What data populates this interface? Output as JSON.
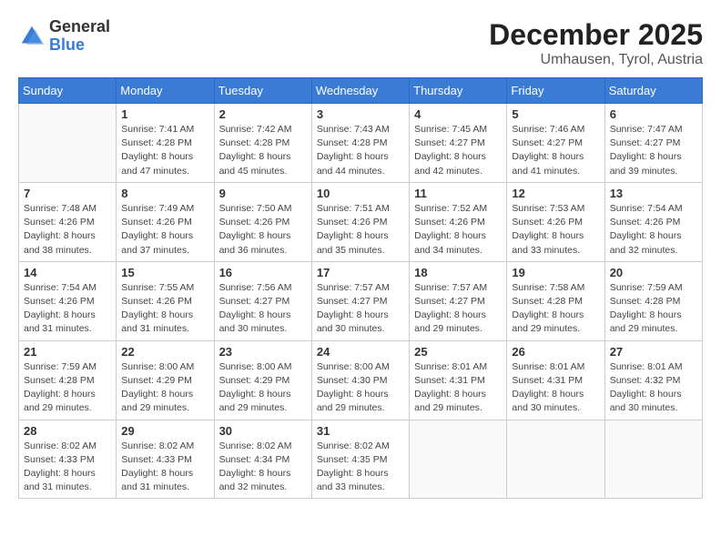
{
  "header": {
    "logo_general": "General",
    "logo_blue": "Blue",
    "month_year": "December 2025",
    "location": "Umhausen, Tyrol, Austria"
  },
  "weekdays": [
    "Sunday",
    "Monday",
    "Tuesday",
    "Wednesday",
    "Thursday",
    "Friday",
    "Saturday"
  ],
  "weeks": [
    [
      {
        "day": "",
        "info": ""
      },
      {
        "day": "1",
        "info": "Sunrise: 7:41 AM\nSunset: 4:28 PM\nDaylight: 8 hours\nand 47 minutes."
      },
      {
        "day": "2",
        "info": "Sunrise: 7:42 AM\nSunset: 4:28 PM\nDaylight: 8 hours\nand 45 minutes."
      },
      {
        "day": "3",
        "info": "Sunrise: 7:43 AM\nSunset: 4:28 PM\nDaylight: 8 hours\nand 44 minutes."
      },
      {
        "day": "4",
        "info": "Sunrise: 7:45 AM\nSunset: 4:27 PM\nDaylight: 8 hours\nand 42 minutes."
      },
      {
        "day": "5",
        "info": "Sunrise: 7:46 AM\nSunset: 4:27 PM\nDaylight: 8 hours\nand 41 minutes."
      },
      {
        "day": "6",
        "info": "Sunrise: 7:47 AM\nSunset: 4:27 PM\nDaylight: 8 hours\nand 39 minutes."
      }
    ],
    [
      {
        "day": "7",
        "info": "Sunrise: 7:48 AM\nSunset: 4:26 PM\nDaylight: 8 hours\nand 38 minutes."
      },
      {
        "day": "8",
        "info": "Sunrise: 7:49 AM\nSunset: 4:26 PM\nDaylight: 8 hours\nand 37 minutes."
      },
      {
        "day": "9",
        "info": "Sunrise: 7:50 AM\nSunset: 4:26 PM\nDaylight: 8 hours\nand 36 minutes."
      },
      {
        "day": "10",
        "info": "Sunrise: 7:51 AM\nSunset: 4:26 PM\nDaylight: 8 hours\nand 35 minutes."
      },
      {
        "day": "11",
        "info": "Sunrise: 7:52 AM\nSunset: 4:26 PM\nDaylight: 8 hours\nand 34 minutes."
      },
      {
        "day": "12",
        "info": "Sunrise: 7:53 AM\nSunset: 4:26 PM\nDaylight: 8 hours\nand 33 minutes."
      },
      {
        "day": "13",
        "info": "Sunrise: 7:54 AM\nSunset: 4:26 PM\nDaylight: 8 hours\nand 32 minutes."
      }
    ],
    [
      {
        "day": "14",
        "info": "Sunrise: 7:54 AM\nSunset: 4:26 PM\nDaylight: 8 hours\nand 31 minutes."
      },
      {
        "day": "15",
        "info": "Sunrise: 7:55 AM\nSunset: 4:26 PM\nDaylight: 8 hours\nand 31 minutes."
      },
      {
        "day": "16",
        "info": "Sunrise: 7:56 AM\nSunset: 4:27 PM\nDaylight: 8 hours\nand 30 minutes."
      },
      {
        "day": "17",
        "info": "Sunrise: 7:57 AM\nSunset: 4:27 PM\nDaylight: 8 hours\nand 30 minutes."
      },
      {
        "day": "18",
        "info": "Sunrise: 7:57 AM\nSunset: 4:27 PM\nDaylight: 8 hours\nand 29 minutes."
      },
      {
        "day": "19",
        "info": "Sunrise: 7:58 AM\nSunset: 4:28 PM\nDaylight: 8 hours\nand 29 minutes."
      },
      {
        "day": "20",
        "info": "Sunrise: 7:59 AM\nSunset: 4:28 PM\nDaylight: 8 hours\nand 29 minutes."
      }
    ],
    [
      {
        "day": "21",
        "info": "Sunrise: 7:59 AM\nSunset: 4:28 PM\nDaylight: 8 hours\nand 29 minutes."
      },
      {
        "day": "22",
        "info": "Sunrise: 8:00 AM\nSunset: 4:29 PM\nDaylight: 8 hours\nand 29 minutes."
      },
      {
        "day": "23",
        "info": "Sunrise: 8:00 AM\nSunset: 4:29 PM\nDaylight: 8 hours\nand 29 minutes."
      },
      {
        "day": "24",
        "info": "Sunrise: 8:00 AM\nSunset: 4:30 PM\nDaylight: 8 hours\nand 29 minutes."
      },
      {
        "day": "25",
        "info": "Sunrise: 8:01 AM\nSunset: 4:31 PM\nDaylight: 8 hours\nand 29 minutes."
      },
      {
        "day": "26",
        "info": "Sunrise: 8:01 AM\nSunset: 4:31 PM\nDaylight: 8 hours\nand 30 minutes."
      },
      {
        "day": "27",
        "info": "Sunrise: 8:01 AM\nSunset: 4:32 PM\nDaylight: 8 hours\nand 30 minutes."
      }
    ],
    [
      {
        "day": "28",
        "info": "Sunrise: 8:02 AM\nSunset: 4:33 PM\nDaylight: 8 hours\nand 31 minutes."
      },
      {
        "day": "29",
        "info": "Sunrise: 8:02 AM\nSunset: 4:33 PM\nDaylight: 8 hours\nand 31 minutes."
      },
      {
        "day": "30",
        "info": "Sunrise: 8:02 AM\nSunset: 4:34 PM\nDaylight: 8 hours\nand 32 minutes."
      },
      {
        "day": "31",
        "info": "Sunrise: 8:02 AM\nSunset: 4:35 PM\nDaylight: 8 hours\nand 33 minutes."
      },
      {
        "day": "",
        "info": ""
      },
      {
        "day": "",
        "info": ""
      },
      {
        "day": "",
        "info": ""
      }
    ]
  ]
}
